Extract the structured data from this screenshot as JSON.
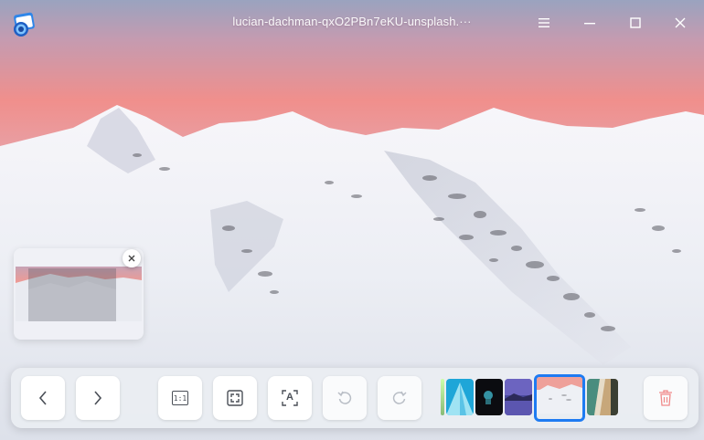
{
  "window": {
    "title": "lucian-dachman-qxO2PBn7eKU-unsplash.···",
    "app_icon": "image-viewer-icon",
    "controls": [
      "menu-icon",
      "minimize-icon",
      "maximize-icon",
      "close-icon"
    ]
  },
  "navigator": {
    "close_icon": "close-icon"
  },
  "toolbar": {
    "buttons": [
      {
        "name": "previous-button",
        "icon": "chevron-left-icon",
        "enabled": true
      },
      {
        "name": "next-button",
        "icon": "chevron-right-icon",
        "enabled": true
      },
      {
        "name": "original-size-button",
        "icon": "one-to-one-icon",
        "enabled": true
      },
      {
        "name": "fit-window-button",
        "icon": "fit-screen-icon",
        "enabled": true
      },
      {
        "name": "ocr-button",
        "icon": "text-recognition-icon",
        "enabled": true
      },
      {
        "name": "rotate-left-button",
        "icon": "rotate-counterclockwise-icon",
        "enabled": false
      },
      {
        "name": "rotate-right-button",
        "icon": "rotate-clockwise-icon",
        "enabled": false
      },
      {
        "name": "delete-button",
        "icon": "trash-icon",
        "enabled": false
      }
    ],
    "ocr_label": "A",
    "ratio_label": "1:1",
    "thumbnails": [
      {
        "name": "thumbnail-partial",
        "current": false
      },
      {
        "name": "thumbnail-blue-mountain",
        "current": false
      },
      {
        "name": "thumbnail-dark-figure",
        "current": false
      },
      {
        "name": "thumbnail-purple-lake",
        "current": false
      },
      {
        "name": "thumbnail-snow-mountain",
        "current": true
      },
      {
        "name": "thumbnail-aerial-beach",
        "current": false
      }
    ]
  },
  "colors": {
    "accent": "#1e7bf2",
    "delete_icon": "#f08a8a",
    "disabled_icon": "#b9bec6",
    "icon": "#4a4f57"
  }
}
